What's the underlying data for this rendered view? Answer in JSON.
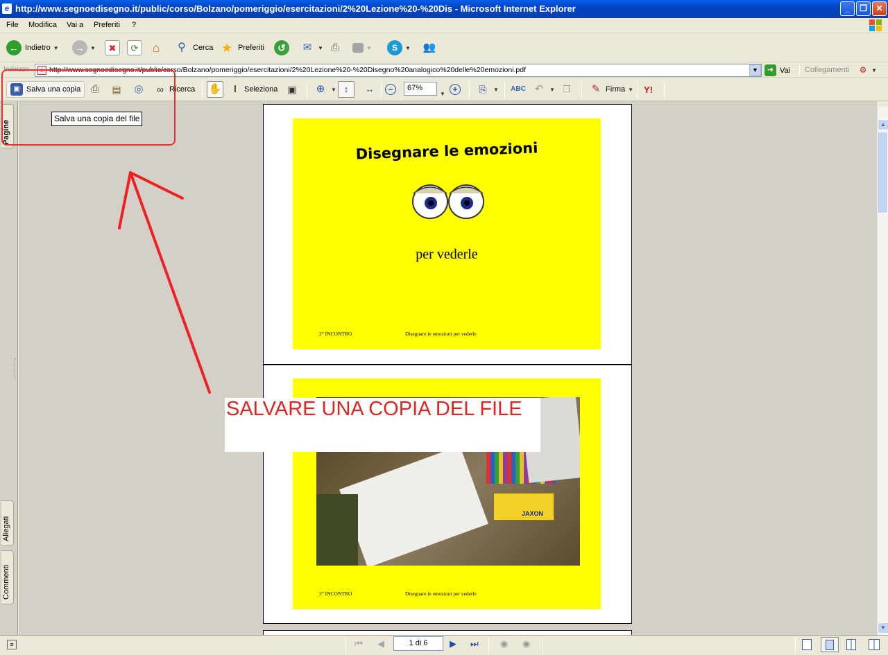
{
  "window": {
    "title": "http://www.segnoedisegno.it/public/corso/Bolzano/pomeriggio/esercitazioni/2%20Lezione%20-%20Dis - Microsoft Internet Explorer",
    "minimize": "_",
    "maximize": "❐",
    "close": "✕"
  },
  "menu": {
    "items": [
      "File",
      "Modifica",
      "Vai a",
      "Preferiti",
      "?"
    ]
  },
  "toolbar": {
    "back_label": "Indietro",
    "search_label": "Cerca",
    "favorites_label": "Preferiti"
  },
  "address": {
    "label": "Indirizzo",
    "url": "http://www.segnoedisegno.it/public/corso/Bolzano/pomeriggio/esercitazioni/2%20Lezione%20-%20Disegno%20analogico%20delle%20emozioni.pdf",
    "go_label": "Vai",
    "links_label": "Collegamenti"
  },
  "pdf_toolbar": {
    "save_copy_label": "Salva una copia",
    "search_label": "Ricerca",
    "select_label": "Seleziona",
    "zoom_value": "67%",
    "sign_label": "Firma",
    "yahoo_label": "Y!"
  },
  "tooltip": "Salva una copia del file",
  "side_tabs": {
    "pages": "Pagine",
    "attachments": "Allegati",
    "comments": "Commenti"
  },
  "slide1": {
    "title": "Disegnare le emozioni",
    "subtitle": "per vederle",
    "footer_left": "2° INCONTRO",
    "footer_right": "Disegnare le emozioni per  vederle"
  },
  "slide2": {
    "footer_left": "2° INCONTRO",
    "footer_right": "Disegnare le emozioni per  vederle",
    "crayon_brand": "JAXON"
  },
  "annotation": {
    "text": "SALVARE UNA COPIA DEL FILE",
    "color": "#e0251f"
  },
  "status": {
    "page_indicator": "1 di 6"
  }
}
